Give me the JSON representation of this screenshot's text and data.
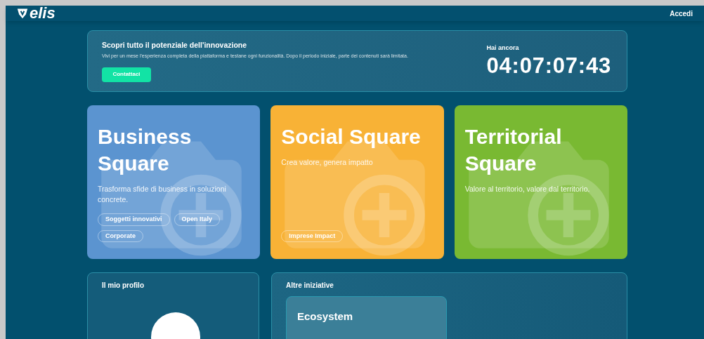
{
  "header": {
    "logo": "elis",
    "login": "Accedi"
  },
  "banner": {
    "title": "Scopri tutto il potenziale dell'innovazione",
    "text": "Vivi per un mese l'esperienza completa della piattaforma e testane ogni funzionalità. Dopo il periodo iniziale, parte dei contenuti sarà limitata.",
    "button": "Contattaci",
    "countdown_label": "Hai ancora",
    "countdown": "04:07:07:43"
  },
  "squares": [
    {
      "title": "Business Square",
      "subtitle": "Trasforma sfide di business in soluzioni concrete.",
      "color": "#5b94d0",
      "tags": [
        "Soggetti innovativi",
        "Open Italy",
        "Corporate"
      ]
    },
    {
      "title": "Social Square",
      "subtitle": "Crea valore, genera impatto",
      "color": "#f8b236",
      "tags": [
        "Imprese Impact"
      ]
    },
    {
      "title": "Territorial Square",
      "subtitle": "Valore al territorio, valore dal territorio.",
      "color": "#79b932"
    }
  ],
  "profile": {
    "title": "Il mio profilo"
  },
  "initiatives": {
    "title": "Altre iniziative",
    "items": [
      {
        "title": "Ecosystem"
      }
    ]
  }
}
